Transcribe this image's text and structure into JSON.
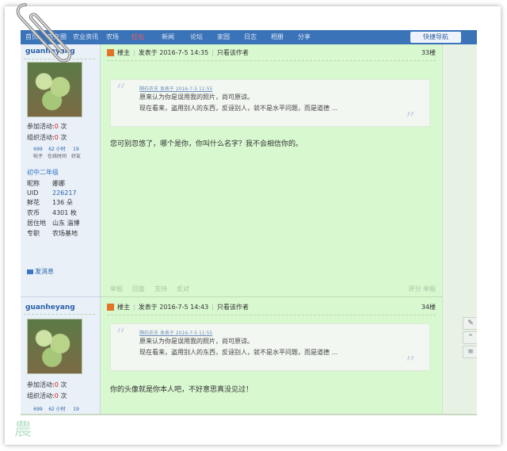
{
  "nav": {
    "items": [
      "首页",
      "农友圈",
      "农业资讯",
      "农场",
      "红包",
      "新闻",
      "论坛",
      "家园",
      "日志",
      "相册",
      "分享"
    ],
    "quick_nav": "快捷导航"
  },
  "posts": [
    {
      "username": "guanheyang",
      "stats": {
        "activity_label": "参加活动:",
        "activity_value": "0",
        "activity_unit": "次",
        "org_label": "组织活动:",
        "org_value": "0",
        "org_unit": "次",
        "mini_values": [
          "699",
          "62 小时",
          "19"
        ],
        "mini_labels": [
          "帖子",
          "在线时间",
          "好友"
        ]
      },
      "level": "初中二年级",
      "info": [
        {
          "k": "昵称",
          "v": "娜娜"
        },
        {
          "k": "UID",
          "v": "226217"
        },
        {
          "k": "鲜花",
          "v": "136 朵"
        },
        {
          "k": "农币",
          "v": "4301 枚"
        },
        {
          "k": "居住地",
          "v": "山东 淄博"
        },
        {
          "k": "专职",
          "v": "农场基地"
        }
      ],
      "pm": "发消息",
      "role": "楼主",
      "posted": "发表于 2016-7-5 14:35",
      "only_author": "只看该作者",
      "floor": "33楼",
      "quote_head": "隔石农夫 发表于 2016-7-5 11:55",
      "quote_line1": "原来认为你是误用我的照片，尚可原谅。",
      "quote_line2": "现在看来，盗用别人的东西，反诬别人，就不是水平问题，而是道德 ...",
      "body": "您可别忽悠了，哪个是你，你叫什么名字？我不会相信你的。",
      "actions": [
        "举报",
        "回复",
        "支持",
        "反对"
      ],
      "actions_right": [
        "评分",
        "举报"
      ]
    },
    {
      "username": "guanheyang",
      "stats": {
        "activity_label": "参加活动:",
        "activity_value": "0",
        "activity_unit": "次",
        "org_label": "组织活动:",
        "org_value": "0",
        "org_unit": "次",
        "mini_values": [
          "699",
          "62 小时",
          "19"
        ]
      },
      "role": "楼主",
      "posted": "发表于 2016-7-5 14:43",
      "only_author": "只看该作者",
      "floor": "34楼",
      "quote_head": "隔石农夫 发表于 2016-7-5 11:55",
      "quote_line1": "原来认为你是误用我的照片，尚可原谅。",
      "quote_line2": "现在看来，盗用别人的东西，反诬别人，就不是水平问题，而是道德 ...",
      "body": "你的头像就是你本人吧，不好意思真没见过！"
    }
  ],
  "side_tools": [
    "comment-icon",
    "top-icon",
    "list-icon"
  ]
}
